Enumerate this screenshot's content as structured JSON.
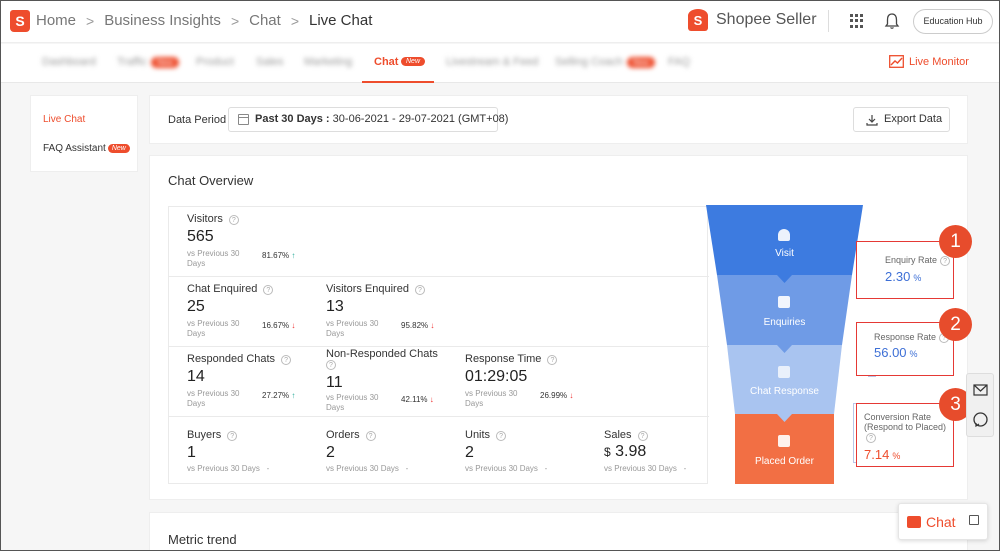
{
  "breadcrumb": {
    "logo_letter": "S",
    "items": [
      "Home",
      "Business Insights",
      "Chat",
      "Live Chat"
    ],
    "separator": ">"
  },
  "brand": {
    "letter": "S",
    "name": "Shopee Seller"
  },
  "header": {
    "education_hub": "Education Hub"
  },
  "nav": {
    "tabs": [
      {
        "label": "Dashboard",
        "badge": ""
      },
      {
        "label": "Traffic",
        "badge": "New"
      },
      {
        "label": "Product",
        "badge": ""
      },
      {
        "label": "Sales",
        "badge": ""
      },
      {
        "label": "Marketing",
        "badge": ""
      },
      {
        "label": "Chat",
        "badge": "New",
        "active": true
      },
      {
        "label": "Livestream & Feed",
        "badge": ""
      },
      {
        "label": "Selling Coach",
        "badge": "New"
      },
      {
        "label": "FAQ",
        "badge": ""
      }
    ],
    "live_monitor": "Live Monitor"
  },
  "sidebar": {
    "items": [
      {
        "label": "Live Chat",
        "active": true
      },
      {
        "label": "FAQ Assistant",
        "badge": "New"
      }
    ]
  },
  "period": {
    "label": "Data Period",
    "range_bold": "Past 30 Days :",
    "range": "30-06-2021 - 29-07-2021 (GMT+08)",
    "export": "Export Data"
  },
  "overview": {
    "title": "Chat Overview",
    "help": "?",
    "vs_prev": "vs Previous 30 Days",
    "metrics": {
      "visitors": {
        "label": "Visitors",
        "value": "565",
        "pct": "81.67%",
        "trend": "up"
      },
      "chat_enquired": {
        "label": "Chat Enquired",
        "value": "25",
        "pct": "16.67%",
        "trend": "down"
      },
      "visitors_enquired": {
        "label": "Visitors Enquired",
        "value": "13",
        "pct": "95.82%",
        "trend": "down"
      },
      "responded_chats": {
        "label": "Responded Chats",
        "value": "14",
        "pct": "27.27%",
        "trend": "up"
      },
      "non_responded_chats": {
        "label": "Non-Responded Chats",
        "value": "11",
        "pct": "42.11%",
        "trend": "down"
      },
      "response_time": {
        "label": "Response Time",
        "value": "01:29:05",
        "pct": "26.99%",
        "trend": "down"
      },
      "buyers": {
        "label": "Buyers",
        "value": "1",
        "pct": "-"
      },
      "orders": {
        "label": "Orders",
        "value": "2",
        "pct": "-"
      },
      "units": {
        "label": "Units",
        "value": "2",
        "pct": "-"
      },
      "sales": {
        "label": "Sales",
        "currency": "$",
        "value": "3.98",
        "pct": "-"
      }
    },
    "funnel": [
      {
        "label": "Visit",
        "color": "#3d7be0"
      },
      {
        "label": "Enquiries",
        "color": "#6f9be6"
      },
      {
        "label": "Chat Response",
        "color": "#a9c4f0"
      },
      {
        "label": "Placed Order",
        "color": "#f26f44"
      }
    ],
    "rates": [
      {
        "label": "Enquiry Rate",
        "value": "2.30",
        "unit": "%",
        "color": "#3d6fd6",
        "step": "1"
      },
      {
        "label": "Response Rate",
        "value": "56.00",
        "unit": "%",
        "color": "#3d6fd6",
        "step": "2"
      },
      {
        "label": "Conversion Rate",
        "label2": "(Respond to Placed)",
        "value": "7.14",
        "unit": "%",
        "color": "#ee4d2d",
        "step": "3"
      }
    ],
    "arrows": {
      "up": "↑",
      "down": "↓"
    }
  },
  "trend": {
    "title": "Metric trend"
  },
  "chat_widget": {
    "label": "Chat"
  }
}
